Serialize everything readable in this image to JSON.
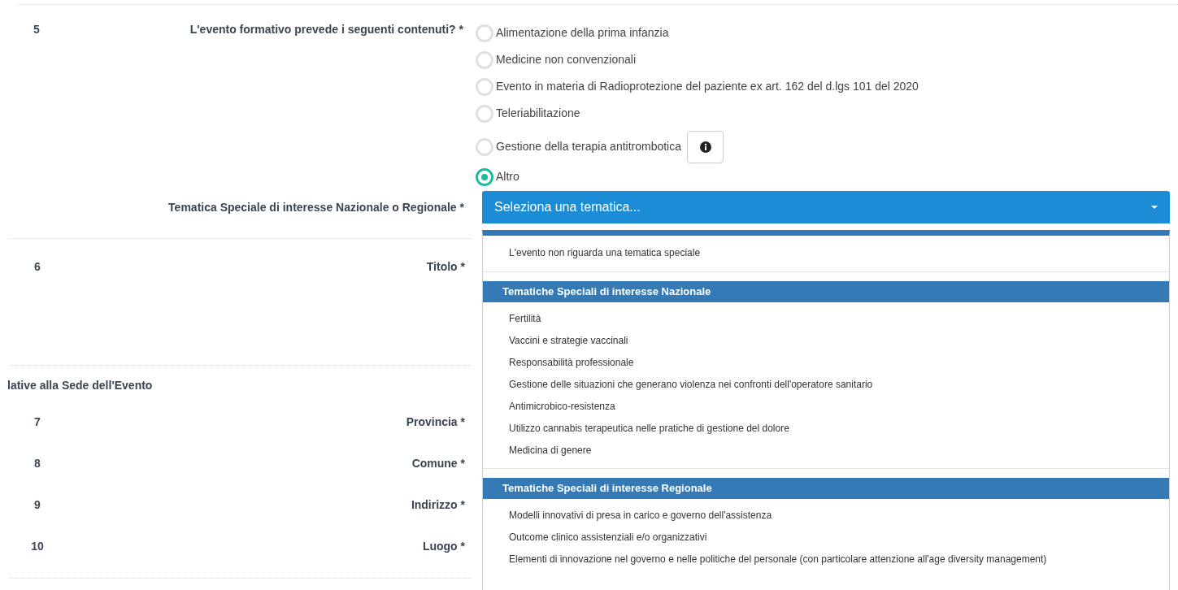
{
  "question_5": {
    "number": "5",
    "label": "L'evento formativo prevede i seguenti contenuti? *",
    "options": [
      {
        "label": "Alimentazione della prima infanzia",
        "selected": false
      },
      {
        "label": "Medicine non convenzionali",
        "selected": false
      },
      {
        "label": "Evento in materia di Radioprotezione del paziente ex art. 162 del d.lgs 101 del 2020",
        "selected": false
      },
      {
        "label": "Teleriabilitazione",
        "selected": false
      },
      {
        "label": "Gestione della terapia antitrombotica",
        "selected": false,
        "info_button": true
      },
      {
        "label": "Altro",
        "selected": true
      }
    ]
  },
  "special_topic": {
    "label": "Tematica Speciale di interesse Nazionale o Regionale *",
    "placeholder": "Seleziona una tematica...",
    "expanded": true,
    "menu": [
      {
        "kind": "option",
        "label": "L'evento non riguarda una tematica speciale"
      },
      {
        "kind": "group",
        "label": "Tematiche Speciali di interesse Nazionale",
        "children": [
          {
            "label": "Fertilità"
          },
          {
            "label": "Vaccini e strategie vaccinali"
          },
          {
            "label": "Responsabilità professionale"
          },
          {
            "label": "Gestione delle situazioni che generano violenza nei confronti dell'operatore sanitario"
          },
          {
            "label": "Antimicrobico-resistenza"
          },
          {
            "label": "Utilizzo cannabis terapeutica nelle pratiche di gestione del dolore"
          },
          {
            "label": "Medicina di genere"
          }
        ]
      },
      {
        "kind": "group",
        "label": "Tematiche Speciali di interesse Regionale",
        "children": [
          {
            "label": "Modelli innovativi di presa in carico e governo dell'assistenza"
          },
          {
            "label": "Outcome clinico assistenziali e/o organizzativi"
          },
          {
            "label": "Elementi di innovazione nel governo e nelle politiche del personale (con particolare attenzione all'age diversity management)"
          }
        ]
      }
    ]
  },
  "title_row": {
    "number": "6",
    "label": "Titolo *"
  },
  "section_heading": "lative alla Sede dell'Evento",
  "location_rows": [
    {
      "number": "7",
      "label": "Provincia *"
    },
    {
      "number": "8",
      "label": "Comune *"
    },
    {
      "number": "9",
      "label": "Indirizzo *"
    },
    {
      "number": "10",
      "label": "Luogo *"
    }
  ]
}
